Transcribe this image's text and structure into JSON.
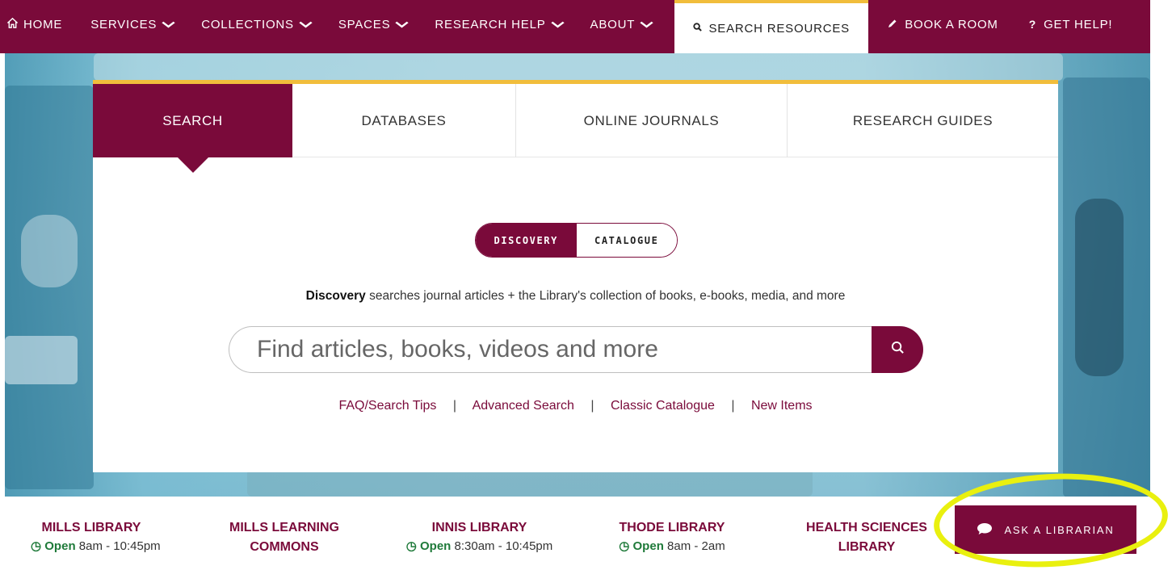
{
  "nav": {
    "home": "HOME",
    "items": [
      {
        "label": "SERVICES"
      },
      {
        "label": "COLLECTIONS"
      },
      {
        "label": "SPACES"
      },
      {
        "label": "RESEARCH HELP"
      },
      {
        "label": "ABOUT"
      }
    ],
    "search_resources": "SEARCH RESOURCES",
    "book_room": "BOOK A ROOM",
    "get_help": "GET HELP!"
  },
  "tabs": [
    {
      "label": "SEARCH",
      "active": true
    },
    {
      "label": "DATABASES"
    },
    {
      "label": "ONLINE JOURNALS"
    },
    {
      "label": "RESEARCH GUIDES"
    }
  ],
  "toggle": {
    "discovery": "DISCOVERY",
    "catalogue": "CATALOGUE",
    "selected": "DISCOVERY"
  },
  "description": {
    "bold": "Discovery",
    "text": " searches journal articles + the Library's collection of books, e-books, media, and more"
  },
  "search": {
    "placeholder": "Find articles, books, videos and more"
  },
  "links": [
    "FAQ/Search Tips",
    "Advanced Search",
    "Classic Catalogue",
    "New Items"
  ],
  "link_separator": "|",
  "locations": [
    {
      "name": "MILLS LIBRARY",
      "status": "Open",
      "hours": "8am - 10:45pm"
    },
    {
      "name": "MILLS LEARNING",
      "name2": "COMMONS"
    },
    {
      "name": "INNIS LIBRARY",
      "status": "Open",
      "hours": "8:30am - 10:45pm"
    },
    {
      "name": "THODE LIBRARY",
      "status": "Open",
      "hours": "8am - 2am"
    },
    {
      "name": "HEALTH SCIENCES",
      "name2": "LIBRARY"
    }
  ],
  "ask": {
    "label": "ASK A LIBRARIAN"
  },
  "colors": {
    "brand": "#7a0a3a",
    "accent": "#f1bd3b",
    "highlight": "#e9f00f",
    "open": "#1f7a3a"
  },
  "icons": [
    "home-icon",
    "chevron-down-icon",
    "search-icon",
    "pencil-icon",
    "question-icon",
    "clock-icon",
    "chat-bubble-icon"
  ]
}
